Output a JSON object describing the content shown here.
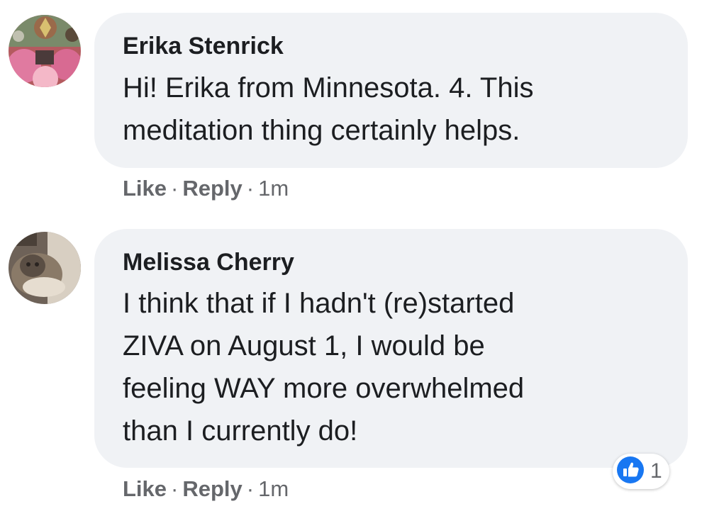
{
  "comments": [
    {
      "author": "Erika Stenrick",
      "text": "Hi! Erika from Minnesota. 4. This\nmeditation thing certainly helps.",
      "actions": {
        "like": "Like",
        "reply": "Reply",
        "separator": "·",
        "time": "1m"
      }
    },
    {
      "author": "Melissa Cherry",
      "text": "I think that if I hadn't (re)started\nZIVA on August 1, I would be\nfeeling WAY more overwhelmed\nthan I currently do!",
      "actions": {
        "like": "Like",
        "reply": "Reply",
        "separator": "·",
        "time": "1m"
      },
      "reaction": {
        "icon": "like-reaction-icon",
        "count": "1"
      }
    }
  ],
  "colors": {
    "bubble": "#f0f2f5",
    "meta": "#65676b",
    "like_blue": "#1877f2"
  }
}
